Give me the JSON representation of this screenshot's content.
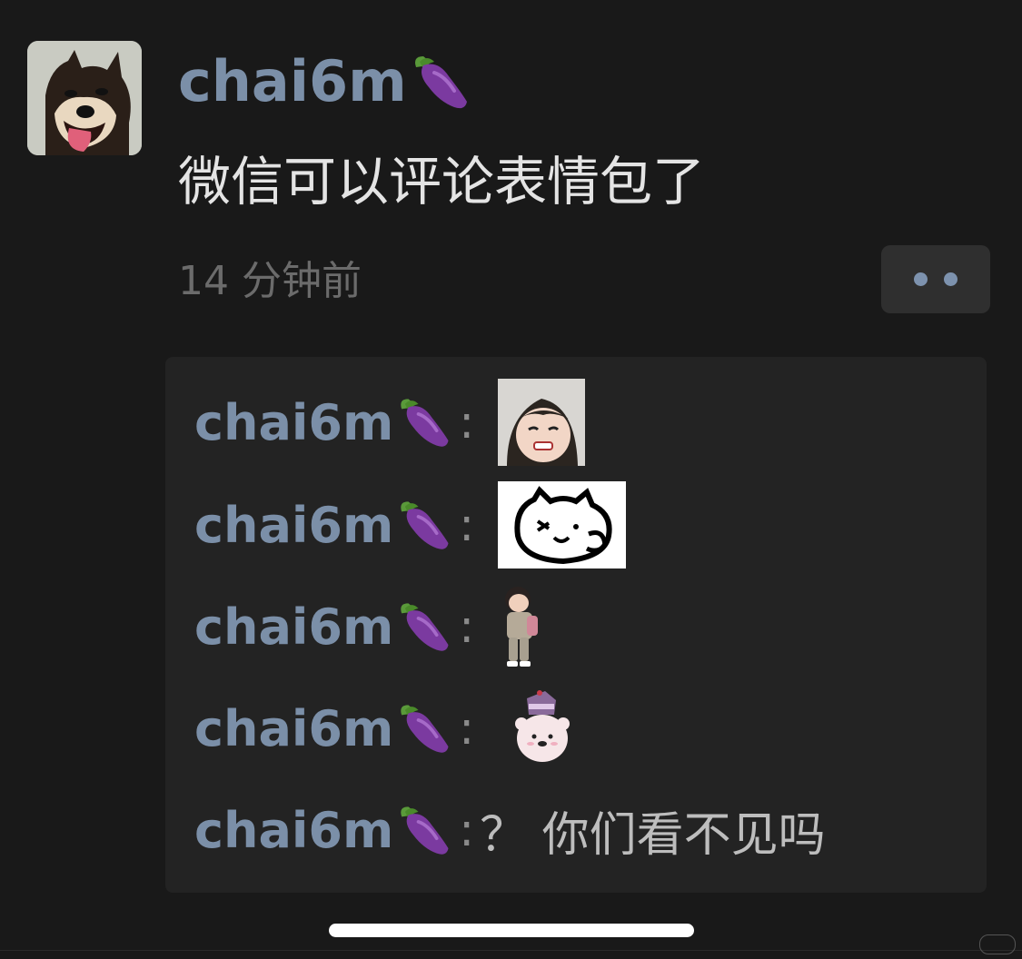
{
  "post": {
    "author": "chai6m",
    "author_emoji": "eggplant",
    "text": "微信可以评论表情包了",
    "time": "14 分钟前"
  },
  "comments": [
    {
      "name": "chai6m",
      "colon": ":",
      "sticker": "crying-child-sticker"
    },
    {
      "name": "chai6m",
      "colon": ":",
      "sticker": "line-drawn-cat-sticker"
    },
    {
      "name": "chai6m",
      "colon": ":",
      "sticker": "toddler-with-backpack-sticker"
    },
    {
      "name": "chai6m",
      "colon": ":",
      "sticker": "bear-with-cake-hat-sticker"
    },
    {
      "name": "chai6m",
      "colon": ":",
      "text": "？ 你们看不见吗"
    }
  ],
  "colors": {
    "background": "#191919",
    "name_blue": "#7b8fa8",
    "comment_bg": "#232323",
    "eggplant": "#7b3aa0"
  }
}
